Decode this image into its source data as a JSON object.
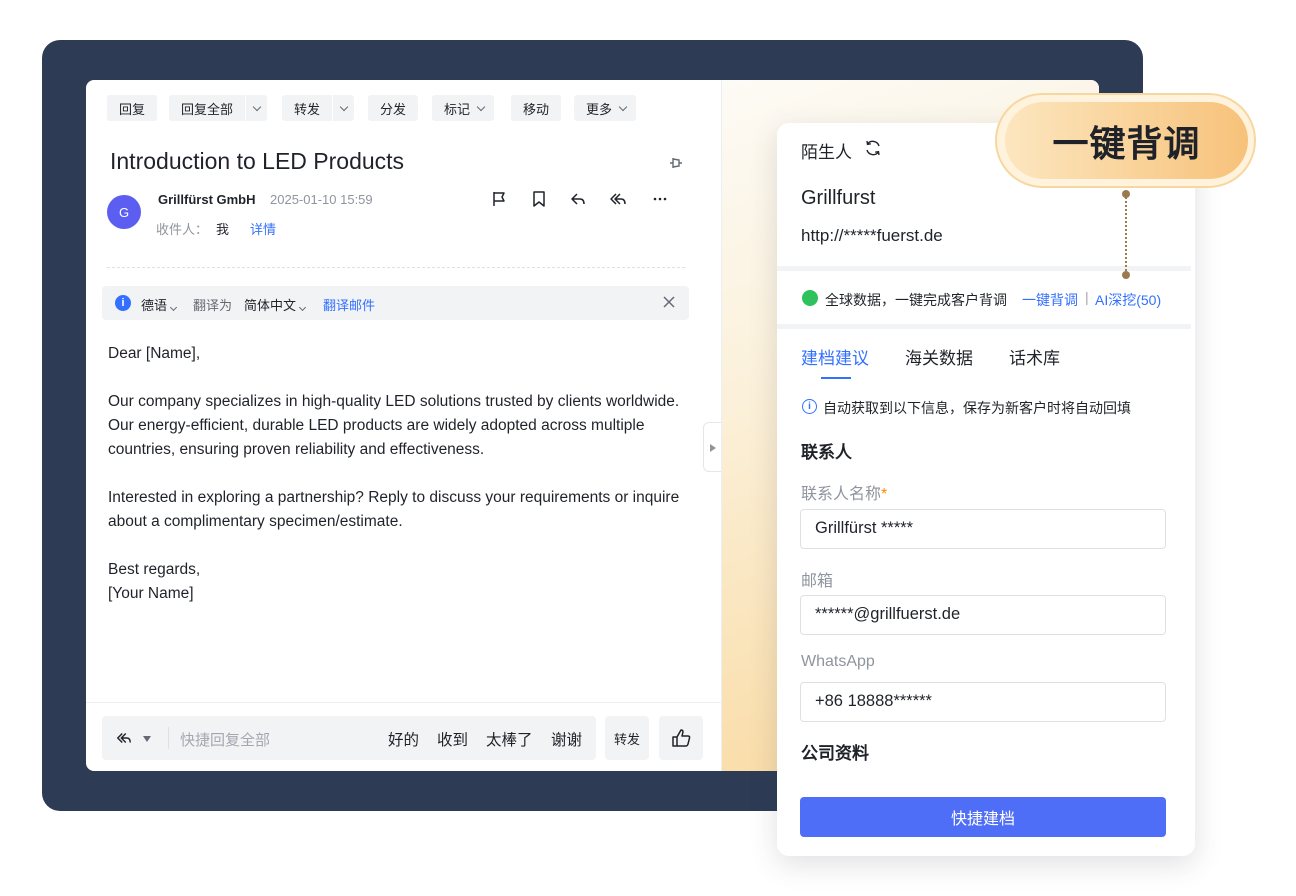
{
  "toolbar": {
    "reply": "回复",
    "reply_all": "回复全部",
    "forward": "转发",
    "distribute": "分发",
    "mark": "标记",
    "move": "移动",
    "more": "更多"
  },
  "email": {
    "subject": "Introduction to LED Products",
    "avatar_letter": "G",
    "sender": "Grillfürst GmbH",
    "date": "2025-01-10 15:59",
    "recipient_label": "收件人：",
    "recipient": "我",
    "details_link": "详情",
    "body": [
      "Dear [Name],",
      "Our company specializes in high-quality LED solutions trusted by clients worldwide. Our energy-efficient, durable LED products are widely adopted across multiple countries, ensuring proven reliability and effectiveness.",
      "Interested in exploring a partnership? Reply to discuss your requirements or inquire about a complimentary specimen/estimate.",
      "Best regards,\n[Your Name]"
    ]
  },
  "translate": {
    "source_lang": "德语",
    "translate_to": "翻译为",
    "target_lang": "简体中文",
    "action": "翻译邮件"
  },
  "quick_reply": {
    "placeholder": "快捷回复全部",
    "options": [
      "好的",
      "收到",
      "太棒了",
      "谢谢"
    ],
    "forward": "转发"
  },
  "crm": {
    "status": "陌生人",
    "company": "Grillfurst",
    "website": "http://*****fuerst.de",
    "global_data_text": "全球数据，一键完成客户背调",
    "global_link_background": "一键背调",
    "separator": "|",
    "global_link_ai": "AI深挖(50)",
    "tabs": [
      "建档建议",
      "海关数据",
      "话术库"
    ],
    "autofill_notice": "自动获取到以下信息，保存为新客户时将自动回填",
    "section_contact": "联系人",
    "field_contact_name_label": "联系人名称",
    "required_mark": "*",
    "field_contact_name": "Grillfürst *****",
    "field_email_label": "邮箱",
    "field_email": "******@grillfuerst.de",
    "field_whatsapp_label": "WhatsApp",
    "field_whatsapp": "+86 18888******",
    "section_company": "公司资料",
    "save_button": "快捷建档"
  },
  "badge": {
    "label": "一键背调"
  },
  "colors": {
    "frame": "#2d3b55",
    "accent_blue": "#3370ff",
    "primary_button": "#4f6ef7",
    "badge_gradient_start": "#fce6bf",
    "badge_gradient_end": "#f7c27a"
  }
}
